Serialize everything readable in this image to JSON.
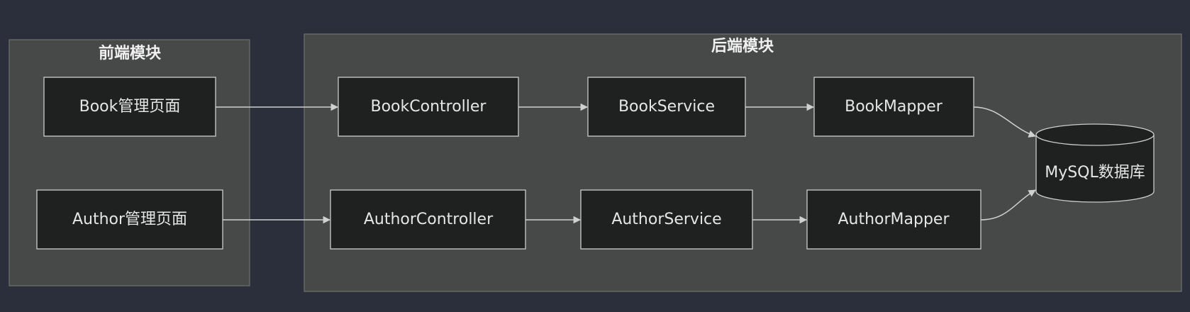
{
  "clusters": {
    "frontend": {
      "title": "前端模块"
    },
    "backend": {
      "title": "后端模块"
    }
  },
  "nodes": {
    "book_page": "Book管理页面",
    "author_page": "Author管理页面",
    "book_controller": "BookController",
    "book_service": "BookService",
    "book_mapper": "BookMapper",
    "author_controller": "AuthorController",
    "author_service": "AuthorService",
    "author_mapper": "AuthorMapper",
    "database": "MySQL数据库"
  },
  "edges": [
    {
      "from": "book_page",
      "to": "book_controller"
    },
    {
      "from": "book_controller",
      "to": "book_service"
    },
    {
      "from": "book_service",
      "to": "book_mapper"
    },
    {
      "from": "book_mapper",
      "to": "database"
    },
    {
      "from": "author_page",
      "to": "author_controller"
    },
    {
      "from": "author_controller",
      "to": "author_service"
    },
    {
      "from": "author_service",
      "to": "author_mapper"
    },
    {
      "from": "author_mapper",
      "to": "database"
    }
  ]
}
